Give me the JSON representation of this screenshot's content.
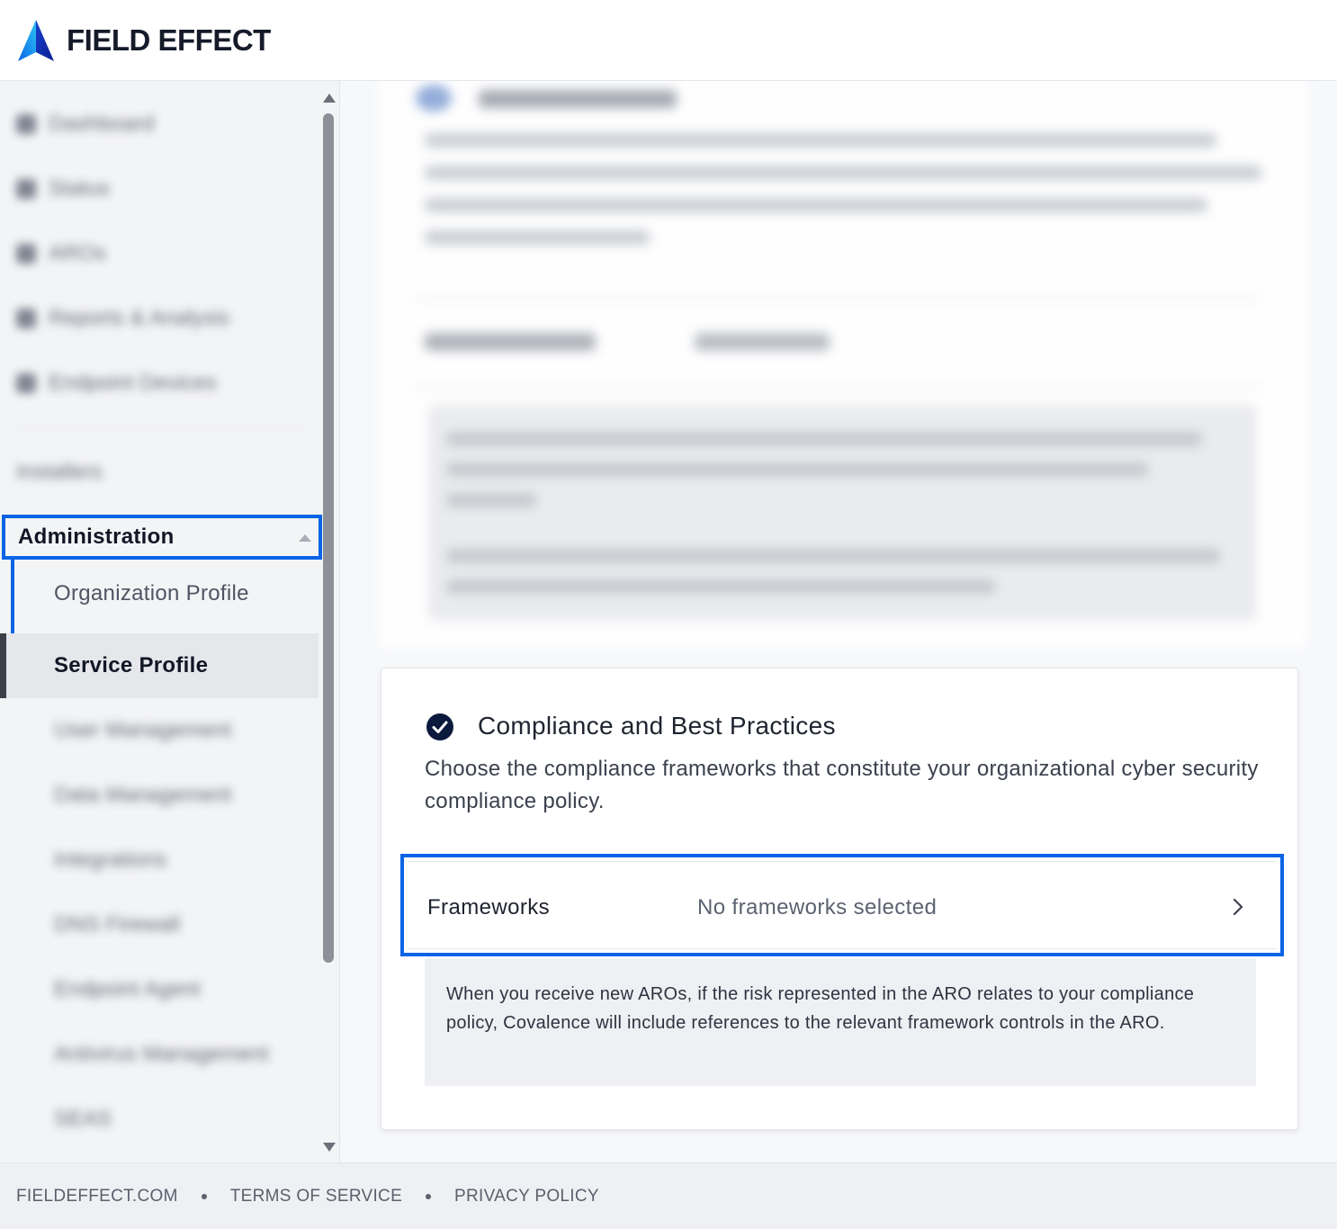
{
  "header": {
    "brand": "FIELD EFFECT"
  },
  "sidebar": {
    "items": [
      {
        "label": "Dashboard"
      },
      {
        "label": "Status"
      },
      {
        "label": "AROs"
      },
      {
        "label": "Reports & Analysis"
      },
      {
        "label": "Endpoint Devices"
      }
    ],
    "installers": "Installers",
    "admin_label": "Administration",
    "admin_items": [
      {
        "label": "Organization Profile"
      },
      {
        "label": "Service Profile",
        "active": true
      },
      {
        "label": "User Management"
      },
      {
        "label": "Data Management"
      },
      {
        "label": "Integrations"
      },
      {
        "label": "DNS Firewall"
      },
      {
        "label": "Endpoint Agent"
      },
      {
        "label": "Antivirus Management"
      },
      {
        "label": "SEAS"
      }
    ]
  },
  "main": {
    "blurred_section": {
      "title": "Threat Response",
      "description": "Configure your preferences for how Covalence takes action in response to threats.",
      "row_label": "Response Policy",
      "row_value": "Alert only"
    },
    "card": {
      "title": "Compliance and Best Practices",
      "description": "Choose the compliance frameworks that constitute your organizational cyber security compliance policy.",
      "frameworks_label": "Frameworks",
      "frameworks_value": "No frameworks selected",
      "note": "When you receive new AROs, if the risk represented in the ARO relates to your compliance policy, Covalence will include references to the relevant framework controls in the ARO."
    }
  },
  "footer": {
    "links": [
      "FIELDEFFECT.COM",
      "TERMS OF SERVICE",
      "PRIVACY POLICY"
    ]
  },
  "colors": {
    "accent": "#0a64e6",
    "brand_navy": "#0b1a3c",
    "sidebar_bg": "#f3f4f6"
  },
  "icons": {
    "logo": "field-effect-logo",
    "check": "check-circle-icon",
    "chevron": "chevron-right-icon"
  }
}
